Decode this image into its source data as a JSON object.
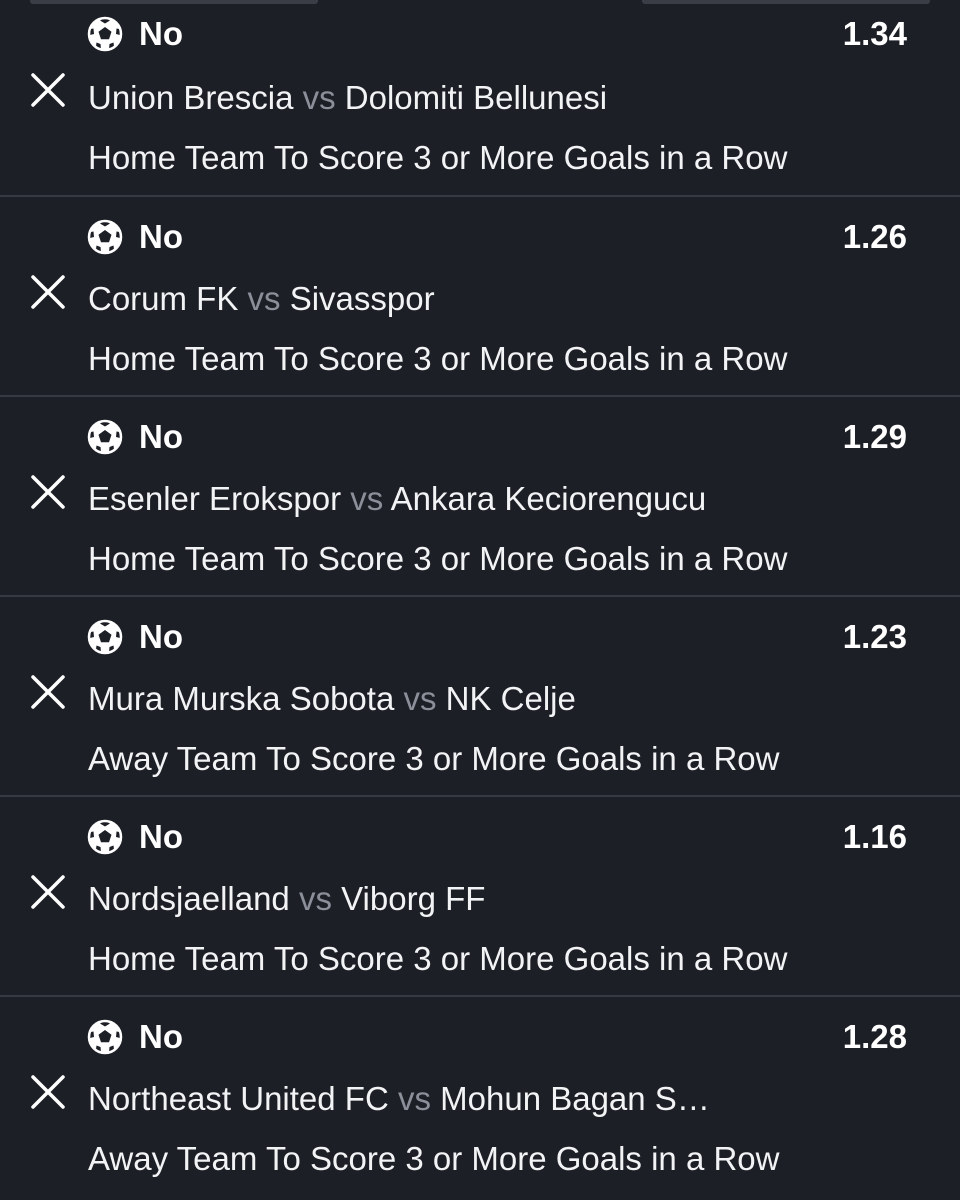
{
  "colors": {
    "background": "#1d1f26",
    "divider": "#363942",
    "text": "#f2f3f5",
    "muted": "#8b8f99"
  },
  "bets": [
    {
      "selection": "No",
      "odds": "1.34",
      "home": "Union Brescia",
      "vs": "vs",
      "away": "Dolomiti Bellunesi",
      "market": "Home Team To Score 3 or More Goals in a Row",
      "icon": "soccer-ball-icon"
    },
    {
      "selection": "No",
      "odds": "1.26",
      "home": "Corum FK",
      "vs": "vs",
      "away": "Sivasspor",
      "market": "Home Team To Score 3 or More Goals in a Row",
      "icon": "soccer-ball-icon"
    },
    {
      "selection": "No",
      "odds": "1.29",
      "home": "Esenler Erokspor",
      "vs": "vs",
      "away": "Ankara Keciorengucu",
      "market": "Home Team To Score 3 or More Goals in a Row",
      "icon": "soccer-ball-icon"
    },
    {
      "selection": "No",
      "odds": "1.23",
      "home": "Mura Murska Sobota",
      "vs": "vs",
      "away": "NK Celje",
      "market": "Away Team To Score 3 or More Goals in a Row",
      "icon": "soccer-ball-icon"
    },
    {
      "selection": "No",
      "odds": "1.16",
      "home": "Nordsjaelland",
      "vs": "vs",
      "away": "Viborg FF",
      "market": "Home Team To Score 3 or More Goals in a Row",
      "icon": "soccer-ball-icon"
    },
    {
      "selection": "No",
      "odds": "1.28",
      "home": "Northeast United FC",
      "vs": "vs",
      "away": "Mohun Bagan S…",
      "market": "Away Team To Score 3 or More Goals in a Row",
      "icon": "soccer-ball-icon"
    }
  ]
}
